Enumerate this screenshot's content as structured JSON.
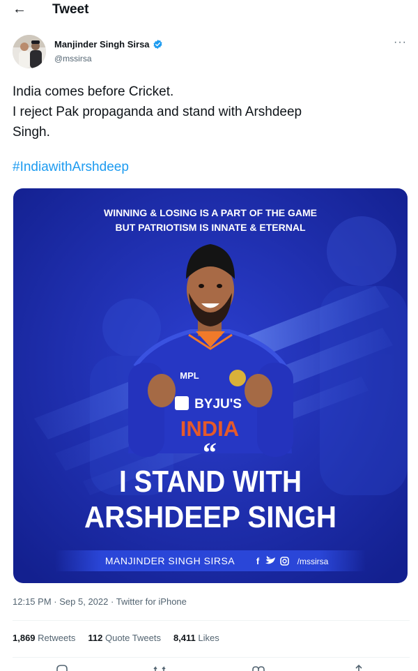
{
  "header": {
    "title": "Tweet",
    "back_icon": "arrow-left-icon"
  },
  "author": {
    "name": "Manjinder Singh Sirsa",
    "handle": "@mssirsa",
    "verified_icon": "verified-badge-icon",
    "more_label": "···"
  },
  "tweet": {
    "lines": [
      "India comes before Cricket.",
      "I reject Pak propaganda and stand with Arshdeep",
      "Singh."
    ],
    "hashtag": "#IndiawithArshdeep"
  },
  "media": {
    "top_line1": "WINNING & LOSING IS A PART OF THE GAME",
    "top_line2": "BUT PATRIOTISM IS INNATE & ETERNAL",
    "jersey_sponsor": "MPL",
    "jersey_brand": "BYJU'S",
    "jersey_team": "INDIA",
    "quote_mark": "“",
    "headline1": "I STAND WITH",
    "headline2": "ARSHDEEP SINGH",
    "footer_name": "MANJINDER SINGH SIRSA",
    "footer_handle": "/mssirsa",
    "colors": {
      "bg": "#1f2fb8",
      "bg_dark": "#121f8e",
      "accent": "#2a4fe0",
      "headline": "#ffffff"
    }
  },
  "meta": {
    "time": "12:15 PM",
    "date": "Sep 5, 2022",
    "source": "Twitter for iPhone",
    "separator": "·"
  },
  "stats": {
    "retweets_count": "1,869",
    "retweets_label": "Retweets",
    "quotes_count": "112",
    "quotes_label": "Quote Tweets",
    "likes_count": "8,411",
    "likes_label": "Likes"
  },
  "actions": [
    "reply-icon",
    "retweet-icon",
    "like-icon",
    "share-icon"
  ]
}
